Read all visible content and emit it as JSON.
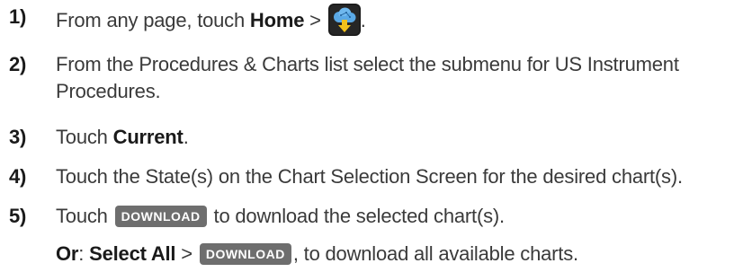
{
  "steps": [
    {
      "number": "1)",
      "pre": "From any page, touch ",
      "bold": "Home",
      "sep": " > ",
      "icon": "cloud-download-app-icon",
      "post": "."
    },
    {
      "number": "2)",
      "line1": "From the Procedures & Charts list select the submenu for US Instrument",
      "line2": "Procedures."
    },
    {
      "number": "3)",
      "pre": "Touch ",
      "bold": "Current",
      "post": "."
    },
    {
      "number": "4)",
      "text": "Touch the State(s) on the Chart Selection Screen for the desired chart(s)."
    },
    {
      "number": "5)",
      "pre": "Touch ",
      "button": "DOWNLOAD",
      "post": " to download the selected chart(s)."
    }
  ],
  "alternate": {
    "or_label": "Or",
    "colon": ": ",
    "select_all": "Select All",
    "sep": " > ",
    "button": "DOWNLOAD",
    "post": ", to download all available charts."
  },
  "colors": {
    "text": "#3a3a3a",
    "button_bg": "#6e6e6e",
    "button_text": "#ffffff",
    "icon_bg": "#1a1a1a",
    "icon_cloud": "#5aa9e6",
    "icon_arrow": "#f2c21b"
  }
}
